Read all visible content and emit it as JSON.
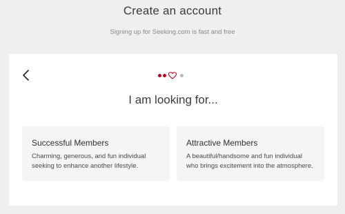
{
  "header": {
    "title": "Create an account",
    "subtitle": "Signing up for Seeking.com is fast and free"
  },
  "card": {
    "back_icon": "chevron-left-icon",
    "progress": {
      "steps": [
        "dot",
        "dot",
        "heart",
        "dot"
      ],
      "current_step": 3,
      "active_color": "#c2001b",
      "inactive_color": "#b9b9b9"
    },
    "question": "I am looking for...",
    "options": [
      {
        "title": "Successful Members",
        "description_line1": "Charming, generous, and fun individual",
        "description_line2": "seeking to enhance another lifestyle."
      },
      {
        "title": "Attractive Members",
        "description_line1": "A beautiful/handsome and fun individual",
        "description_line2": "who brings excitement into the atmosphere."
      }
    ]
  }
}
